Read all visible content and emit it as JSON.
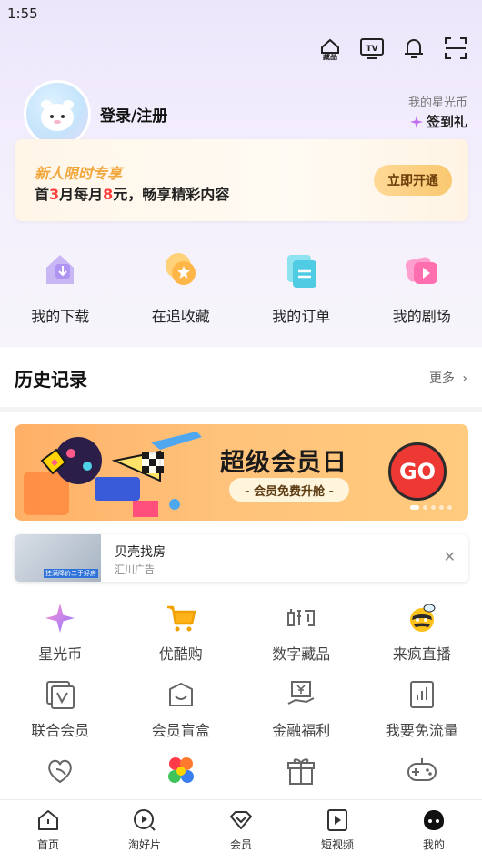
{
  "status_bar": {
    "time": "1:55"
  },
  "top_actions": {
    "collection_badge": "藏品",
    "tv_badge": "TV"
  },
  "profile": {
    "login_label": "登录/注册"
  },
  "star_coin": {
    "label": "我的星光币",
    "sign_in": "签到礼"
  },
  "vip_banner": {
    "tag": "新人限时专享",
    "desc_prefix": "首",
    "desc_months": "3",
    "desc_mid": "月每月",
    "desc_price": "8",
    "desc_suffix": "元，畅享精彩内容",
    "button": "立即开通"
  },
  "quick_links": [
    {
      "label": "我的下载",
      "icon": "download-icon"
    },
    {
      "label": "在追收藏",
      "icon": "favorite-icon"
    },
    {
      "label": "我的订单",
      "icon": "order-icon"
    },
    {
      "label": "我的剧场",
      "icon": "theater-icon"
    }
  ],
  "history": {
    "title": "历史记录",
    "more": "更多"
  },
  "promo": {
    "title": "超级会员日",
    "subtitle": "- 会员免费升舱 -",
    "go": "GO"
  },
  "ad": {
    "name": "贝壳找房",
    "source": "汇川广告",
    "thumb_caption": "挂满降价二手好房"
  },
  "services": [
    {
      "label": "星光币",
      "icon": "star-coin-icon"
    },
    {
      "label": "优酷购",
      "icon": "cart-icon"
    },
    {
      "label": "数字藏品",
      "icon": "digital-collection-icon"
    },
    {
      "label": "来疯直播",
      "icon": "bee-icon"
    },
    {
      "label": "联合会员",
      "icon": "joint-member-icon"
    },
    {
      "label": "会员盲盒",
      "icon": "blind-box-icon"
    },
    {
      "label": "金融福利",
      "icon": "finance-icon"
    },
    {
      "label": "我要免流量",
      "icon": "data-free-icon"
    },
    {
      "label": "",
      "icon": "heart-leaf-icon"
    },
    {
      "label": "",
      "icon": "game-blocks-icon"
    },
    {
      "label": "",
      "icon": "gift-icon"
    },
    {
      "label": "",
      "icon": "gamepad-icon"
    }
  ],
  "tabbar": [
    {
      "label": "首页",
      "icon": "home-icon"
    },
    {
      "label": "淘好片",
      "icon": "discover-icon"
    },
    {
      "label": "会员",
      "icon": "vip-icon"
    },
    {
      "label": "短视频",
      "icon": "short-video-icon"
    },
    {
      "label": "我的",
      "icon": "profile-icon"
    }
  ],
  "colors": {
    "accent_orange": "#f0a63a",
    "highlight_red": "#ff3b3b",
    "promo_orange": "#ffb067",
    "go_red": "#ee3834"
  }
}
